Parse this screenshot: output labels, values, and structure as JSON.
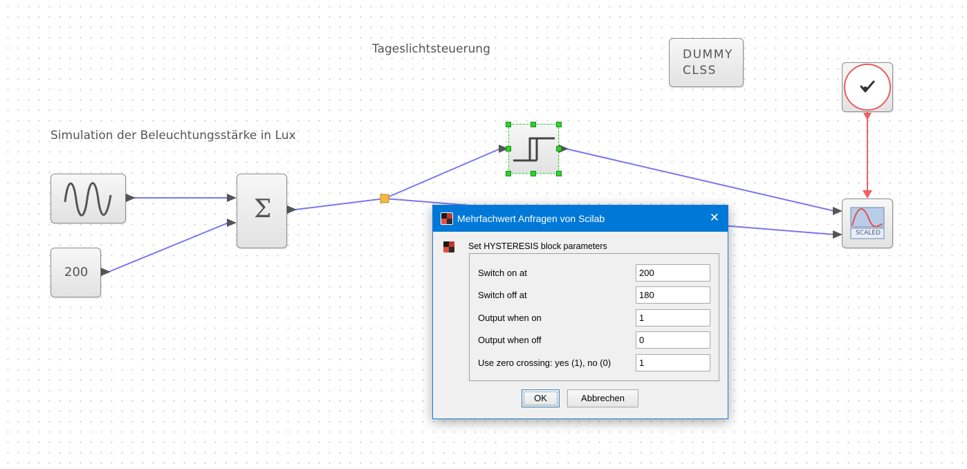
{
  "diagram": {
    "title_label": "Tageslichtsteuerung",
    "subtitle_label": "Simulation der Beleuchtungsstärke in Lux",
    "blocks": {
      "dummy_clss": {
        "line1": "DUMMY",
        "line2": "CLSS"
      },
      "constant": {
        "value": "200"
      },
      "sum": {
        "symbol": "Σ"
      },
      "scope": {
        "badge": "SCALED"
      }
    },
    "colors": {
      "data_wire": "#7777ee",
      "event_wire": "#f06060",
      "selection": "#2bd42b",
      "split_point": "#f5b942"
    }
  },
  "dialog": {
    "title": "Mehrfachwert Anfragen von Scilab",
    "heading": "Set HYSTERESIS block parameters",
    "fields": [
      {
        "label": "Switch on at",
        "value": "200"
      },
      {
        "label": "Switch off at",
        "value": "180"
      },
      {
        "label": "Output when on",
        "value": "1"
      },
      {
        "label": "Output when off",
        "value": "0"
      },
      {
        "label": "Use zero crossing: yes (1), no (0)",
        "value": "1"
      }
    ],
    "ok_label": "OK",
    "cancel_label": "Abbrechen"
  }
}
